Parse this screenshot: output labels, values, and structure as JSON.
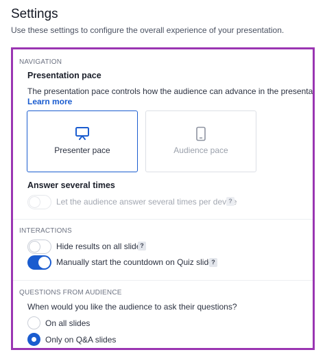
{
  "page": {
    "title": "Settings",
    "subtitle": "Use these settings to configure the overall experience of your presentation."
  },
  "navigation": {
    "section_label": "NAVIGATION",
    "pace_heading": "Presentation pace",
    "pace_description": "The presentation pace controls how the audience can advance in the presentation.",
    "learn_more": "Learn more",
    "cards": [
      {
        "label": "Presenter pace",
        "icon": "presenter-screen-icon",
        "selected": true
      },
      {
        "label": "Audience pace",
        "icon": "mobile-phone-icon",
        "selected": false
      }
    ],
    "answer_heading": "Answer several times",
    "answer_toggle": {
      "label": "Let the audience answer several times per device",
      "on": false,
      "disabled": true,
      "help": "?"
    }
  },
  "interactions": {
    "section_label": "INTERACTIONS",
    "toggles": [
      {
        "label": "Hide results on all slides",
        "on": false,
        "help": "?"
      },
      {
        "label": "Manually start the countdown on Quiz slides",
        "on": true,
        "help": "?"
      }
    ]
  },
  "questions": {
    "section_label": "QUESTIONS FROM AUDIENCE",
    "prompt": "When would you like the audience to ask their questions?",
    "options": [
      {
        "label": "On all slides",
        "selected": false
      },
      {
        "label": "Only on Q&A slides",
        "selected": true
      }
    ]
  },
  "colors": {
    "accent": "#1a5ccf",
    "frame_highlight": "#9a35b2"
  }
}
